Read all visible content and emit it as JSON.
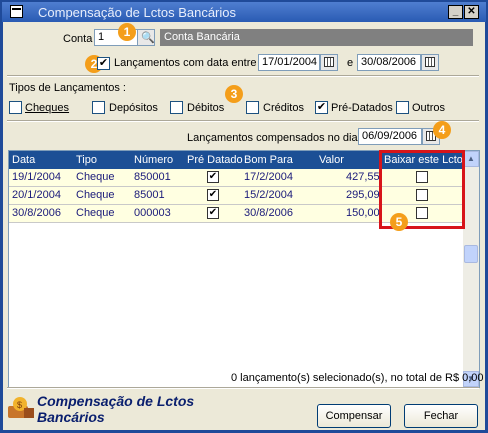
{
  "window": {
    "title": "Compensação de Lctos Bancários"
  },
  "conta": {
    "label": "Conta",
    "value": "1",
    "name": "Conta Bancária"
  },
  "periodo": {
    "checkbox_label": "Lançamentos com data entre",
    "checked": true,
    "date_from": "17/01/2004",
    "conjunction": "e",
    "date_to": "30/08/2006"
  },
  "tipos": {
    "title": "Tipos de Lançamentos :",
    "items": [
      {
        "label": "Cheques",
        "checked": false
      },
      {
        "label": "Depósitos",
        "checked": false
      },
      {
        "label": "Débitos",
        "checked": false
      },
      {
        "label": "Créditos",
        "checked": false
      },
      {
        "label": "Pré-Datados",
        "checked": true
      },
      {
        "label": "Outros",
        "checked": false
      }
    ]
  },
  "compensados": {
    "label": "Lançamentos compensados no dia",
    "date": "06/09/2006"
  },
  "grid": {
    "columns": [
      "Data",
      "Tipo",
      "Número",
      "Pré Datado",
      "Bom Para",
      "Valor",
      "Baixar este Lcto"
    ],
    "rows": [
      {
        "data": "19/1/2004",
        "tipo": "Cheque",
        "numero": "850001",
        "pre_datado": true,
        "bom_para": "17/2/2004",
        "valor": "427,55",
        "baixar": false
      },
      {
        "data": "20/1/2004",
        "tipo": "Cheque",
        "numero": "85001",
        "pre_datado": true,
        "bom_para": "15/2/2004",
        "valor": "295,09",
        "baixar": false
      },
      {
        "data": "30/8/2006",
        "tipo": "Cheque",
        "numero": "000003",
        "pre_datado": true,
        "bom_para": "30/8/2006",
        "valor": "150,00",
        "baixar": false
      }
    ]
  },
  "status": {
    "text": "0 lançamento(s) selecionado(s), no total de R$ 0,00"
  },
  "footer": {
    "brand_line1": "Compensação de Lctos",
    "brand_line2": "Bancários"
  },
  "buttons": {
    "compensar": "Compensar",
    "fechar": "Fechar"
  },
  "annotations": [
    "1",
    "2",
    "3",
    "4",
    "5"
  ],
  "colors": {
    "titlebar": "#2a5bb3",
    "grid_header": "#1c4f95",
    "row_bg": "#ffffe1",
    "badge": "#f49e1a",
    "highlight": "#d7141a"
  }
}
